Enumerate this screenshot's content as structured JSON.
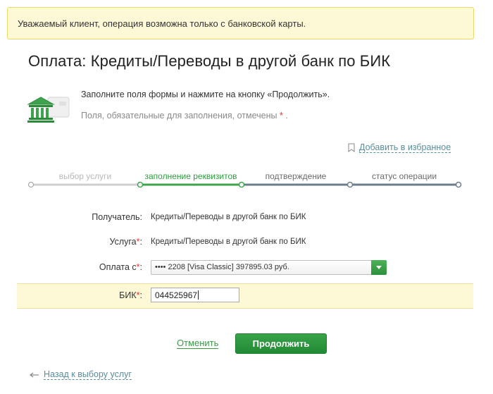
{
  "notice": {
    "text": "Уважаемый клиент, операция возможна только с банковской карты."
  },
  "page": {
    "title": "Оплата: Кредиты/Переводы в другой банк по БИК"
  },
  "instructions": {
    "line1": "Заполните поля формы и нажмите на кнопку «Продолжить».",
    "line2": "Поля, обязательные для заполнения, отмечены",
    "required_mark": "*",
    "line2_end": "."
  },
  "favorites": {
    "label": "Добавить в избранное",
    "icon": "bookmark-icon"
  },
  "steps": [
    {
      "label": "выбор услуги",
      "state": "done"
    },
    {
      "label": "заполнение реквизитов",
      "state": "active"
    },
    {
      "label": "подтверждение",
      "state": "todo"
    },
    {
      "label": "статус операции",
      "state": "todo"
    }
  ],
  "form": {
    "recipient": {
      "label": "Получатель:",
      "value": "Кредиты/Переводы в другой банк по БИК"
    },
    "service": {
      "label": "Услуга",
      "required": "*",
      "colon": ":",
      "value": "Кредиты/Переводы в другой банк по БИК"
    },
    "payment_from": {
      "label": "Оплата с",
      "required": "*",
      "colon": ":",
      "selected": "•••• 2208 [Visa Classic] 397895.03 руб."
    },
    "bik": {
      "label": "БИК",
      "required": "*",
      "colon": ":",
      "value": "044525967"
    }
  },
  "actions": {
    "cancel": "Отменить",
    "continue": "Продолжить",
    "back": "Назад к выбору услуг"
  },
  "colors": {
    "accent_green": "#2e9c3e",
    "notice_bg": "#fdf8d6",
    "link_blue": "#5a8e9b",
    "required_red": "#e3302f"
  }
}
